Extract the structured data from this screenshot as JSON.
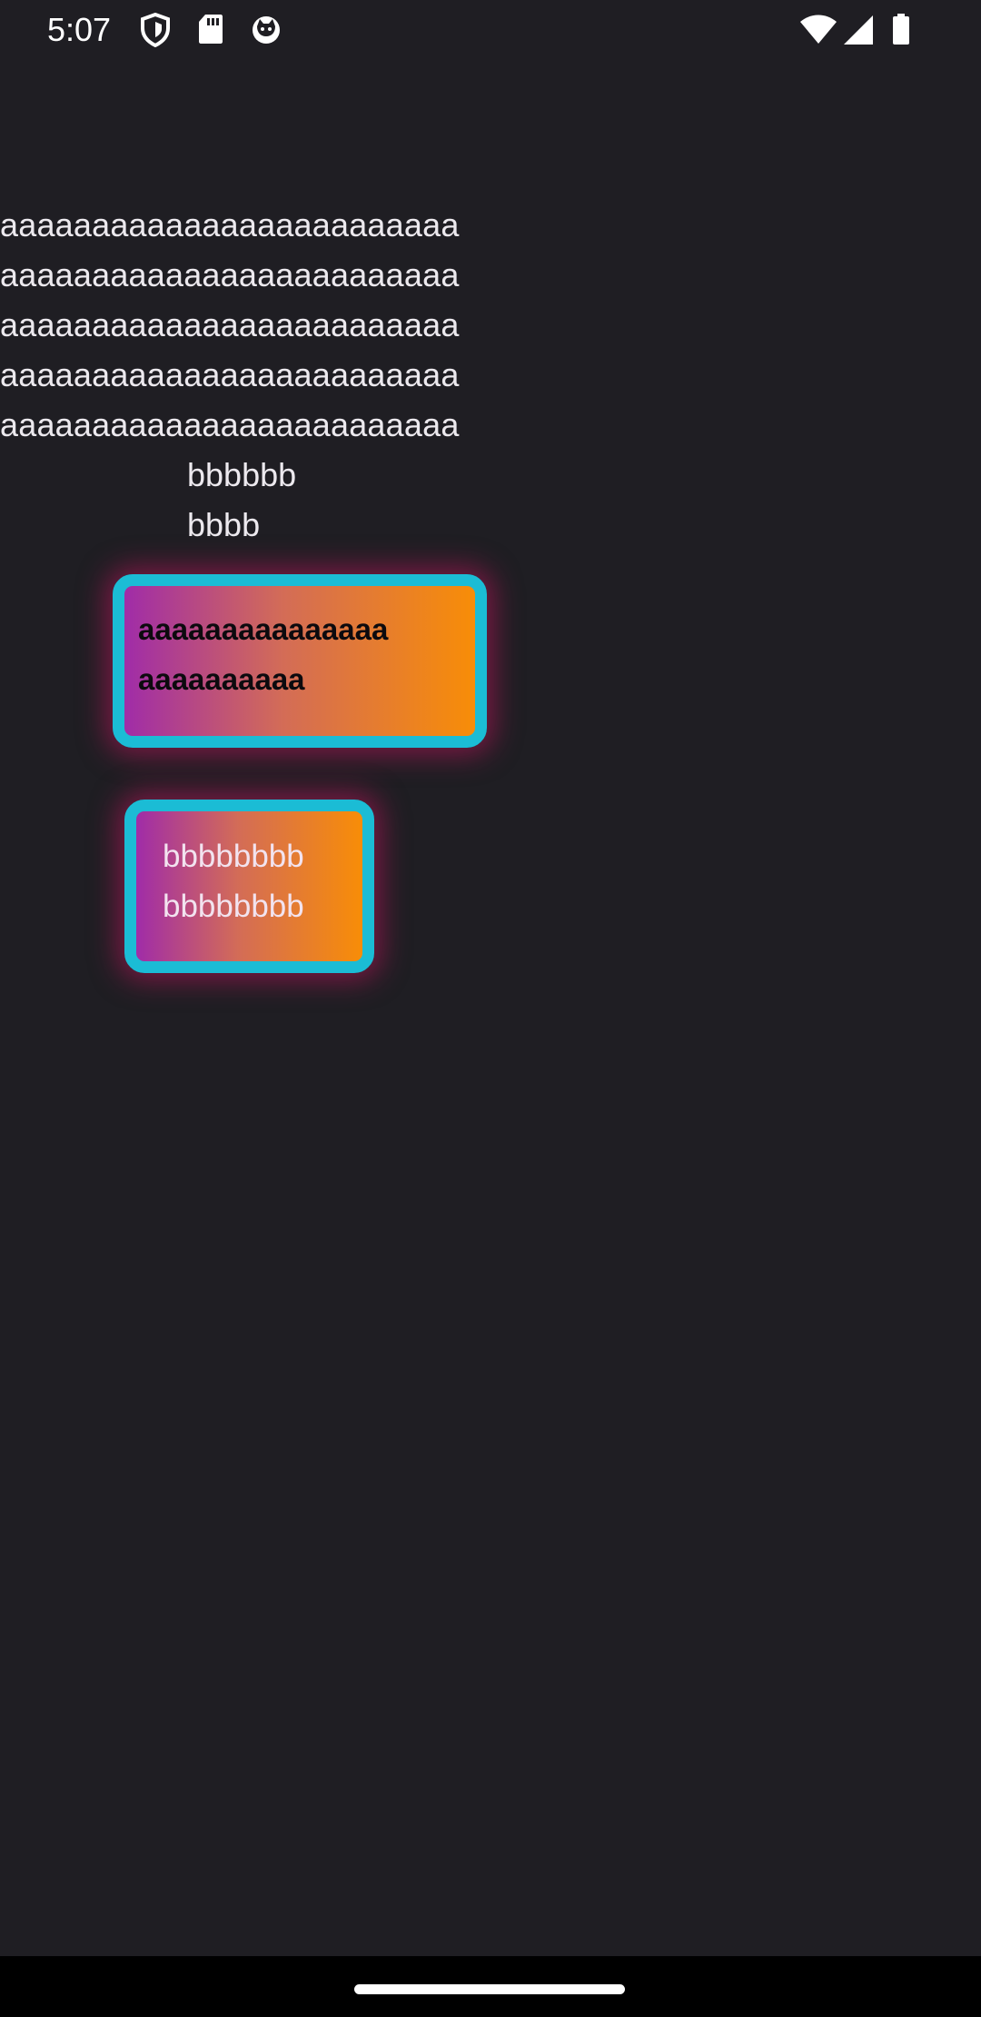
{
  "status_bar": {
    "time": "5:07",
    "icons": [
      "shield-icon",
      "sd-card-icon",
      "cat-icon",
      "wifi-icon",
      "cell-signal-icon",
      "battery-icon"
    ]
  },
  "content": {
    "text_a": "aaaaaaaaaaaaaaaaaaaaaaaaa\naaaaaaaaaaaaaaaaaaaaaaaaa\naaaaaaaaaaaaaaaaaaaaaaaaa\naaaaaaaaaaaaaaaaaaaaaaaaa\naaaaaaaaaaaaaaaaaaaaaaaaa",
    "text_b": "bbbbbb\nbbbb",
    "card_1_text": "aaaaaaaaaaaaaaa\naaaaaaaaaa",
    "card_2_text": "bbbbbbbb\nbbbbbbbb"
  },
  "colors": {
    "background": "#1f1e23",
    "card_border": "#1bbcd5",
    "gradient_start": "#a02ca8",
    "gradient_end": "#f88d07",
    "glow": "#c4145f"
  }
}
